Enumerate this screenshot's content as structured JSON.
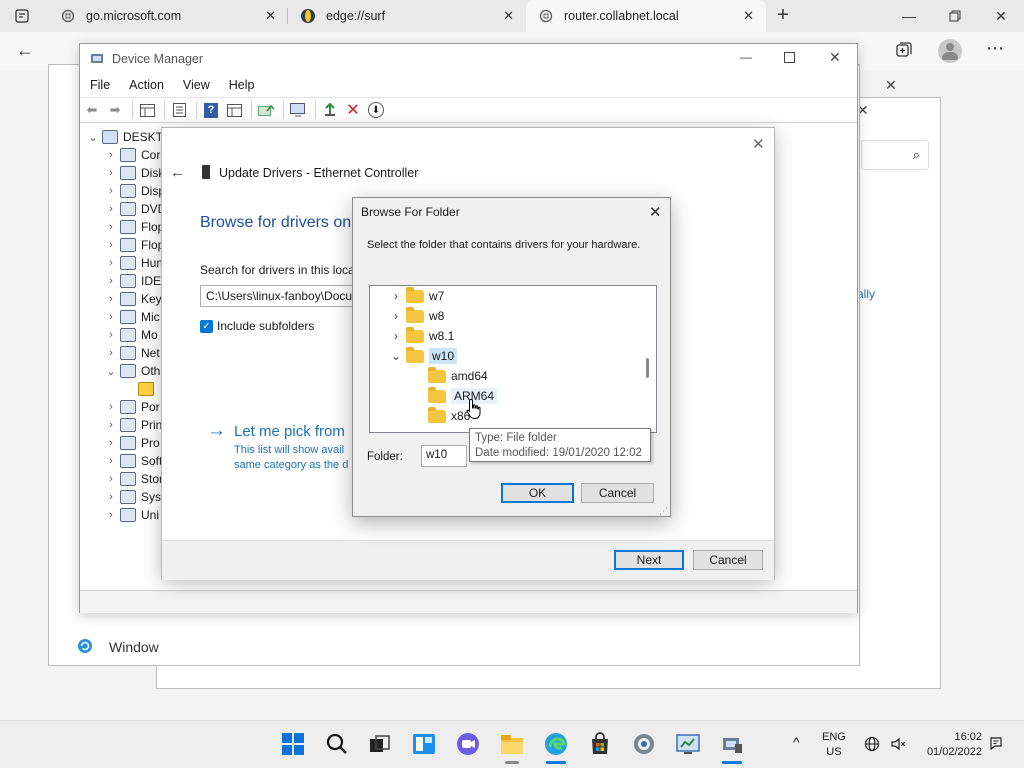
{
  "browser": {
    "tabs": [
      {
        "title": "go.microsoft.com"
      },
      {
        "title": "edge://surf"
      },
      {
        "title": "router.collabnet.local"
      }
    ],
    "new_tab_symbol": "+"
  },
  "background_windows": {
    "right_link_fragment": "ally",
    "windows_label": "Window"
  },
  "device_manager": {
    "title": "Device Manager",
    "menu": [
      "File",
      "Action",
      "View",
      "Help"
    ],
    "root": "DESKTO",
    "tree_items": [
      "Cor",
      "Disk",
      "Disp",
      "DVD",
      "Flop",
      "Flop",
      "Hum",
      "IDE",
      "Key",
      "Mic",
      "Mo",
      "Net",
      "Oth",
      "",
      "Por",
      "Prin",
      "Pro",
      "Soft",
      "Stor",
      "Syst",
      "Uni"
    ]
  },
  "update_drivers": {
    "header": "Update Drivers - Ethernet Controller",
    "heading": "Browse for drivers on",
    "search_label": "Search for drivers in this locat",
    "path_value": "C:\\Users\\linux-fanboy\\Docu",
    "include_subfolders": "Include subfolders",
    "pick_link": "Let me pick from",
    "pick_desc_1": "This list will show avail",
    "pick_desc_2": "same category as the d",
    "next_button": "Next",
    "cancel_button": "Cancel"
  },
  "browse_folder": {
    "title": "Browse For Folder",
    "instruction": "Select the folder that contains drivers for your hardware.",
    "folders": [
      {
        "name": "w7"
      },
      {
        "name": "w8"
      },
      {
        "name": "w8.1"
      },
      {
        "name": "w10"
      },
      {
        "name": "amd64"
      },
      {
        "name": "ARM64"
      },
      {
        "name": "x86"
      }
    ],
    "folder_label": "Folder:",
    "folder_value": "w10",
    "ok_button": "OK",
    "cancel_button": "Cancel",
    "tooltip_line1": "Type: File folder",
    "tooltip_line2": "Date modified: 19/01/2020 12:02"
  },
  "taskbar": {
    "lang": "ENG",
    "region": "US",
    "time": "16:02",
    "date": "01/02/2022"
  },
  "colors": {
    "accent": "#0078d4",
    "link": "#1a73b8",
    "folder": "#f5c542"
  }
}
